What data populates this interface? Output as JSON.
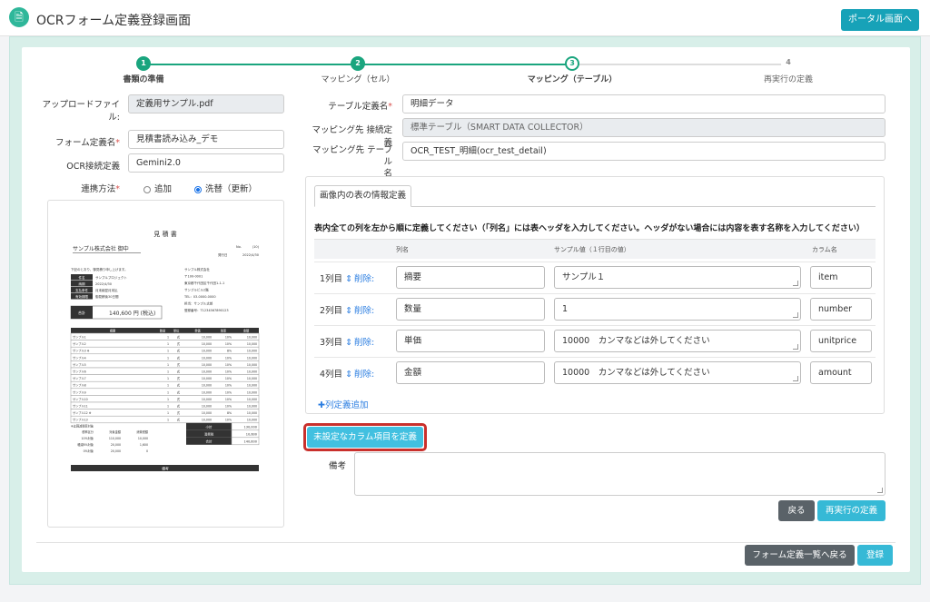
{
  "app": {
    "title": "OCRフォーム定義登録画面",
    "portal_button": "ポータル画面へ"
  },
  "steps": [
    {
      "num": "1",
      "label": "書類の準備"
    },
    {
      "num": "2",
      "label": "マッピング（セル）"
    },
    {
      "num": "3",
      "label": "マッピング（テーブル）"
    },
    {
      "num": "4",
      "label": "再実行の定義"
    }
  ],
  "left_form": {
    "upload_label": "アップロードファイル:",
    "upload_value": "定義用サンプル.pdf",
    "form_name_label": "フォーム定義名",
    "form_name_value": "見積書読み込み_デモ",
    "ocr_label": "OCR接続定義",
    "ocr_value": "Gemini2.0",
    "link_label": "連携方法",
    "link_options": [
      "追加",
      "洗替（更新）"
    ],
    "link_selected": "洗替（更新）"
  },
  "preview": {
    "doc_title": "見 積 書",
    "customer": "サンプル株式会社 御中",
    "no_label": "No.",
    "no_value": "(10)",
    "date_label": "発行日",
    "date_value": "2022/4/30",
    "greeting": "下記のとおり、御見積り申し上げます。",
    "fields": [
      {
        "k": "件名",
        "v": "サンプルプロジェクト"
      },
      {
        "k": "納期",
        "v": "2022/4/30"
      },
      {
        "k": "支払条件",
        "v": "月末締翌月末払"
      },
      {
        "k": "有効期限",
        "v": "御見積後30日間"
      }
    ],
    "company": [
      "サンプル株式会社",
      "〒100-0001",
      "東京都千代田区千代田1-1-1",
      "サンプルビル2階",
      "TEL：03-0000-0000",
      "担当：サンプル太郎",
      "登録番号：T1234567890123"
    ],
    "total_label": "合計",
    "total_value": "140,600 円 (税込)",
    "table_headers": [
      "摘要",
      "数量",
      "単位",
      "単価",
      "税率",
      "金額"
    ],
    "table_rows": [
      [
        "サンプル1",
        "1",
        "式",
        "10,000",
        "10%",
        "10,000"
      ],
      [
        "サンプル2",
        "1",
        "式",
        "10,000",
        "10%",
        "10,000"
      ],
      [
        "サンプル3 ※",
        "1",
        "式",
        "10,000",
        "8%",
        "10,000"
      ],
      [
        "サンプル4",
        "1",
        "式",
        "10,000",
        "10%",
        "10,000"
      ],
      [
        "サンプル5",
        "1",
        "式",
        "10,000",
        "10%",
        "10,000"
      ],
      [
        "サンプル6",
        "1",
        "式",
        "10,000",
        "10%",
        "10,000"
      ],
      [
        "サンプル7",
        "1",
        "式",
        "10,000",
        "10%",
        "10,000"
      ],
      [
        "サンプル8",
        "1",
        "式",
        "10,000",
        "10%",
        "10,000"
      ],
      [
        "サンプル9",
        "1",
        "式",
        "10,000",
        "10%",
        "10,000"
      ],
      [
        "サンプル10",
        "1",
        "式",
        "10,000",
        "10%",
        "10,000"
      ],
      [
        "サンプル11",
        "1",
        "式",
        "10,000",
        "10%",
        "10,000"
      ],
      [
        "サンプル12 ※",
        "1",
        "式",
        "10,000",
        "8%",
        "10,000"
      ],
      [
        "サンプル13",
        "1",
        "式",
        "10,000",
        "10%",
        "10,000"
      ]
    ],
    "tax_note": "※は軽減税率対象",
    "summary": [
      {
        "k": "小計",
        "v": "130,000"
      },
      {
        "k": "消費税",
        "v": "10,600"
      },
      {
        "k": "合計",
        "v": "140,600"
      }
    ],
    "tax_table": [
      [
        "税率区分",
        "対象金額",
        "消費税額"
      ],
      [
        "10%対象",
        "110,000",
        "10,000"
      ],
      [
        "軽減8%対象",
        "20,000",
        "1,600"
      ],
      [
        "0%対象",
        "20,000",
        "0"
      ]
    ],
    "remarks_label": "備考"
  },
  "right_form": {
    "table_def_label": "テーブル定義名",
    "table_def_value": "明細データ",
    "conn_label": "マッピング先 接続定義",
    "conn_value": "標準テーブル（SMART DATA COLLECTOR）",
    "target_label_1": "マッピング先 テーブル",
    "target_label_2": "名",
    "target_value": "OCR_TEST_明細(ocr_test_detail)"
  },
  "tab": {
    "label": "画像内の表の情報定義"
  },
  "instruction": "表内全ての列を左から順に定義してください（「列名」には表ヘッダを入力してください。ヘッダがない場合には内容を表す名称を入力してください）",
  "columns_header": {
    "name": "列名",
    "sample": "サンプル値（１行目の値）",
    "column": "カラム名"
  },
  "columns": [
    {
      "idx": "1列目",
      "delete": "削除:",
      "name": "摘要",
      "sample": "サンプル１",
      "column": "item"
    },
    {
      "idx": "2列目",
      "delete": "削除:",
      "name": "数量",
      "sample": "1",
      "column": "number"
    },
    {
      "idx": "3列目",
      "delete": "削除:",
      "name": "単価",
      "sample": "10000　カンマなどは外してください",
      "column": "unitprice"
    },
    {
      "idx": "4列目",
      "delete": "削除:",
      "name": "金額",
      "sample": "10000　カンマなどは外してください",
      "column": "amount"
    }
  ],
  "add_column": "✚列定義追加",
  "undefined_button": "未設定なカラム項目を定義",
  "remarks_label": "備考",
  "buttons": {
    "back": "戻る",
    "rerun": "再実行の定義",
    "back_list": "フォーム定義一覧へ戻る",
    "register": "登録"
  },
  "colors": {
    "teal": "#17a2b8",
    "step_green": "#1aa57e",
    "highlight": "#c9302c",
    "link": "#2a7de1"
  }
}
